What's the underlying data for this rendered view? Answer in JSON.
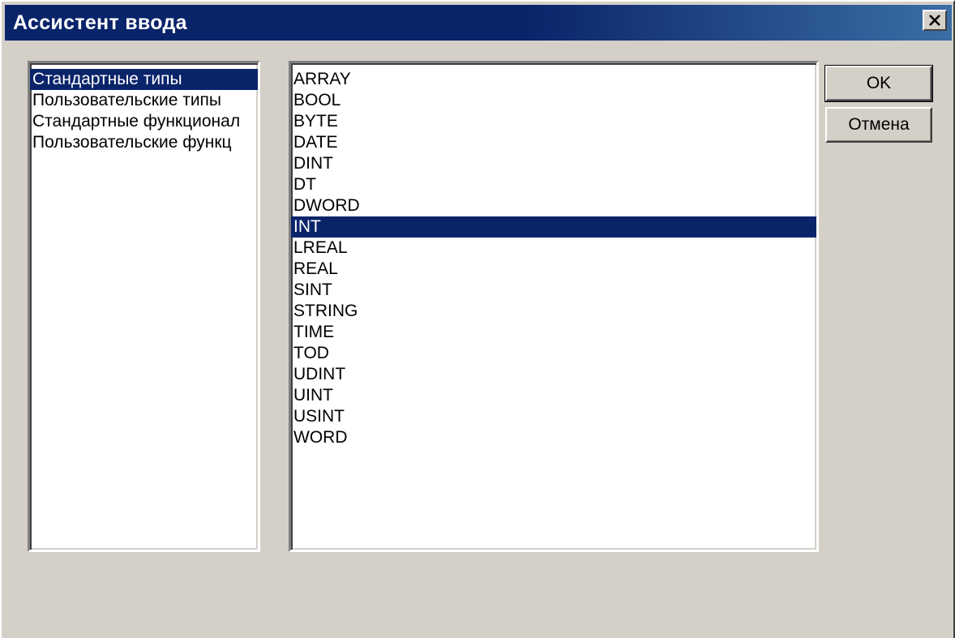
{
  "window": {
    "title": "Ассистент ввода"
  },
  "categories": {
    "items": [
      {
        "label": "Стандартные типы",
        "selected": true
      },
      {
        "label": "Пользовательские типы",
        "selected": false
      },
      {
        "label": "Стандартные функционал",
        "selected": false
      },
      {
        "label": "Пользовательские функц",
        "selected": false
      }
    ]
  },
  "types": {
    "items": [
      {
        "label": "ARRAY",
        "selected": false
      },
      {
        "label": "BOOL",
        "selected": false
      },
      {
        "label": "BYTE",
        "selected": false
      },
      {
        "label": "DATE",
        "selected": false
      },
      {
        "label": "DINT",
        "selected": false
      },
      {
        "label": "DT",
        "selected": false
      },
      {
        "label": "DWORD",
        "selected": false
      },
      {
        "label": "INT",
        "selected": true
      },
      {
        "label": "LREAL",
        "selected": false
      },
      {
        "label": "REAL",
        "selected": false
      },
      {
        "label": "SINT",
        "selected": false
      },
      {
        "label": "STRING",
        "selected": false
      },
      {
        "label": "TIME",
        "selected": false
      },
      {
        "label": "TOD",
        "selected": false
      },
      {
        "label": "UDINT",
        "selected": false
      },
      {
        "label": "UINT",
        "selected": false
      },
      {
        "label": "USINT",
        "selected": false
      },
      {
        "label": "WORD",
        "selected": false
      }
    ]
  },
  "buttons": {
    "ok_label": "OK",
    "cancel_label": "Отмена"
  },
  "icons": {
    "close": "close-icon"
  },
  "colors": {
    "title_bar": "#0a246a",
    "selection": "#0a246a",
    "face": "#d4d0c8"
  }
}
